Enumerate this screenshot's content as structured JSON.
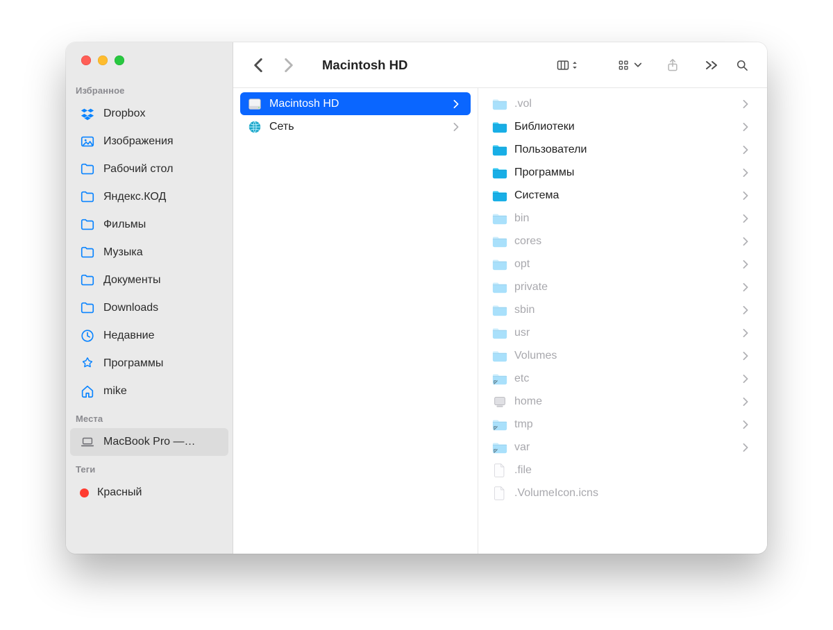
{
  "window": {
    "title": "Macintosh HD"
  },
  "traffic_tooltips": {
    "close": "Close",
    "min": "Minimize",
    "zoom": "Zoom"
  },
  "sidebar": {
    "sections": {
      "favorites_title": "Избранное",
      "locations_title": "Места",
      "tags_title": "Теги"
    },
    "favorites": [
      {
        "id": "dropbox",
        "label": "Dropbox",
        "icon": "dropbox"
      },
      {
        "id": "images",
        "label": "Изображения",
        "icon": "images"
      },
      {
        "id": "desktop",
        "label": "Рабочий стол",
        "icon": "folder"
      },
      {
        "id": "yandex",
        "label": "Яндекс.КОД",
        "icon": "folder"
      },
      {
        "id": "movies",
        "label": "Фильмы",
        "icon": "folder"
      },
      {
        "id": "music",
        "label": "Музыка",
        "icon": "folder"
      },
      {
        "id": "documents",
        "label": "Документы",
        "icon": "folder"
      },
      {
        "id": "downloads",
        "label": "Downloads",
        "icon": "folder"
      },
      {
        "id": "recents",
        "label": "Недавние",
        "icon": "clock"
      },
      {
        "id": "apps",
        "label": "Программы",
        "icon": "apps"
      },
      {
        "id": "home",
        "label": "mike",
        "icon": "home"
      }
    ],
    "locations": [
      {
        "id": "macbook",
        "label": "MacBook Pro —…",
        "icon": "laptop",
        "selected": true
      }
    ],
    "tags": [
      {
        "id": "red",
        "label": "Красный",
        "color": "#ff3b30"
      }
    ]
  },
  "columns": [
    {
      "id": "devices",
      "items": [
        {
          "id": "mac-hd",
          "label": "Macintosh HD",
          "kind": "hd",
          "has_children": true,
          "selected": true
        },
        {
          "id": "network",
          "label": "Сеть",
          "kind": "globe",
          "has_children": true,
          "selected": false
        }
      ]
    },
    {
      "id": "root",
      "items": [
        {
          "id": "vol",
          "label": ".vol",
          "kind": "folder-fade",
          "has_children": true,
          "muted": true
        },
        {
          "id": "lib",
          "label": "Библиотеки",
          "kind": "folder-teal",
          "has_children": true,
          "muted": false
        },
        {
          "id": "users",
          "label": "Пользователи",
          "kind": "folder-teal",
          "has_children": true,
          "muted": false
        },
        {
          "id": "apps",
          "label": "Программы",
          "kind": "folder-teal",
          "has_children": true,
          "muted": false
        },
        {
          "id": "system",
          "label": "Система",
          "kind": "folder-teal",
          "has_children": true,
          "muted": false
        },
        {
          "id": "bin",
          "label": "bin",
          "kind": "folder-fade",
          "has_children": true,
          "muted": true
        },
        {
          "id": "cores",
          "label": "cores",
          "kind": "folder-fade",
          "has_children": true,
          "muted": true
        },
        {
          "id": "opt",
          "label": "opt",
          "kind": "folder-fade",
          "has_children": true,
          "muted": true
        },
        {
          "id": "private",
          "label": "private",
          "kind": "folder-fade",
          "has_children": true,
          "muted": true
        },
        {
          "id": "sbin",
          "label": "sbin",
          "kind": "folder-fade",
          "has_children": true,
          "muted": true
        },
        {
          "id": "usr",
          "label": "usr",
          "kind": "folder-fade",
          "has_children": true,
          "muted": true
        },
        {
          "id": "volumes",
          "label": "Volumes",
          "kind": "folder-fade",
          "has_children": true,
          "muted": true
        },
        {
          "id": "etc",
          "label": "etc",
          "kind": "alias",
          "has_children": true,
          "muted": true
        },
        {
          "id": "home",
          "label": "home",
          "kind": "mount",
          "has_children": true,
          "muted": true
        },
        {
          "id": "tmp",
          "label": "tmp",
          "kind": "alias",
          "has_children": true,
          "muted": true
        },
        {
          "id": "var",
          "label": "var",
          "kind": "alias",
          "has_children": true,
          "muted": true
        },
        {
          "id": "file",
          "label": ".file",
          "kind": "file",
          "has_children": false,
          "muted": true
        },
        {
          "id": "volicon",
          "label": ".VolumeIcon.icns",
          "kind": "file",
          "has_children": false,
          "muted": true
        }
      ]
    }
  ],
  "toolbar": {
    "back": "Back",
    "forward": "Forward",
    "view": "Column view",
    "group": "Group",
    "share": "Share",
    "overflow": "More",
    "search": "Search"
  }
}
